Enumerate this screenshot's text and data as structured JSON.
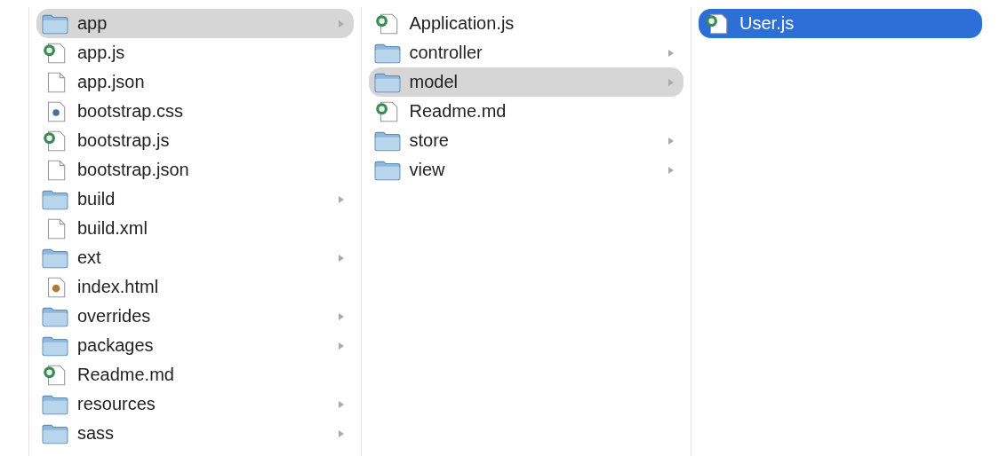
{
  "columns": [
    {
      "focused": false,
      "items": [
        {
          "name": "app",
          "kind": "folder",
          "selected": true
        },
        {
          "name": "app.js",
          "kind": "script",
          "selected": false
        },
        {
          "name": "app.json",
          "kind": "file",
          "selected": false
        },
        {
          "name": "bootstrap.css",
          "kind": "css",
          "selected": false
        },
        {
          "name": "bootstrap.js",
          "kind": "script",
          "selected": false
        },
        {
          "name": "bootstrap.json",
          "kind": "file",
          "selected": false
        },
        {
          "name": "build",
          "kind": "folder",
          "selected": false
        },
        {
          "name": "build.xml",
          "kind": "file",
          "selected": false
        },
        {
          "name": "ext",
          "kind": "folder",
          "selected": false
        },
        {
          "name": "index.html",
          "kind": "html",
          "selected": false
        },
        {
          "name": "overrides",
          "kind": "folder",
          "selected": false
        },
        {
          "name": "packages",
          "kind": "folder",
          "selected": false
        },
        {
          "name": "Readme.md",
          "kind": "script",
          "selected": false
        },
        {
          "name": "resources",
          "kind": "folder",
          "selected": false
        },
        {
          "name": "sass",
          "kind": "folder",
          "selected": false
        }
      ]
    },
    {
      "focused": false,
      "items": [
        {
          "name": "Application.js",
          "kind": "script",
          "selected": false
        },
        {
          "name": "controller",
          "kind": "folder",
          "selected": false
        },
        {
          "name": "model",
          "kind": "folder",
          "selected": true
        },
        {
          "name": "Readme.md",
          "kind": "script",
          "selected": false
        },
        {
          "name": "store",
          "kind": "folder",
          "selected": false
        },
        {
          "name": "view",
          "kind": "folder",
          "selected": false
        }
      ]
    },
    {
      "focused": true,
      "items": [
        {
          "name": "User.js",
          "kind": "script",
          "selected": true
        }
      ]
    }
  ]
}
